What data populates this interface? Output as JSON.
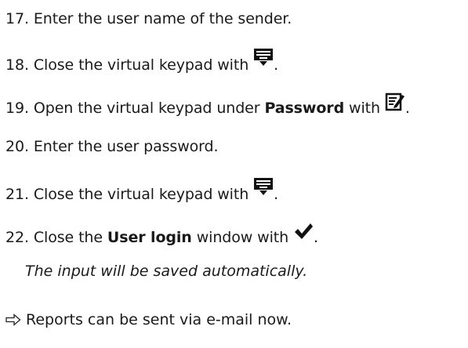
{
  "steps": [
    {
      "num": "17.",
      "text": "Enter the user name of the sender."
    },
    {
      "num": "18.",
      "text_before": "Close the virtual keypad with",
      "icon": "keyboard-close-icon",
      "text_after": "."
    },
    {
      "num": "19.",
      "text_before": "Open the virtual keypad under",
      "bold": "Password",
      "text_mid": "with",
      "icon": "edit-document-icon",
      "text_after": "."
    },
    {
      "num": "20.",
      "text": "Enter the user password."
    },
    {
      "num": "21.",
      "text_before": "Close the virtual keypad with",
      "icon": "keyboard-close-icon",
      "text_after": "."
    },
    {
      "num": "22.",
      "text_before": "Close the",
      "bold": "User login",
      "text_mid": "window with",
      "icon": "checkmark-icon",
      "text_after": "."
    }
  ],
  "note": "The input will be saved automatically.",
  "result": {
    "icon": "result-arrow-icon",
    "text": "Reports can be sent via e-mail now."
  }
}
